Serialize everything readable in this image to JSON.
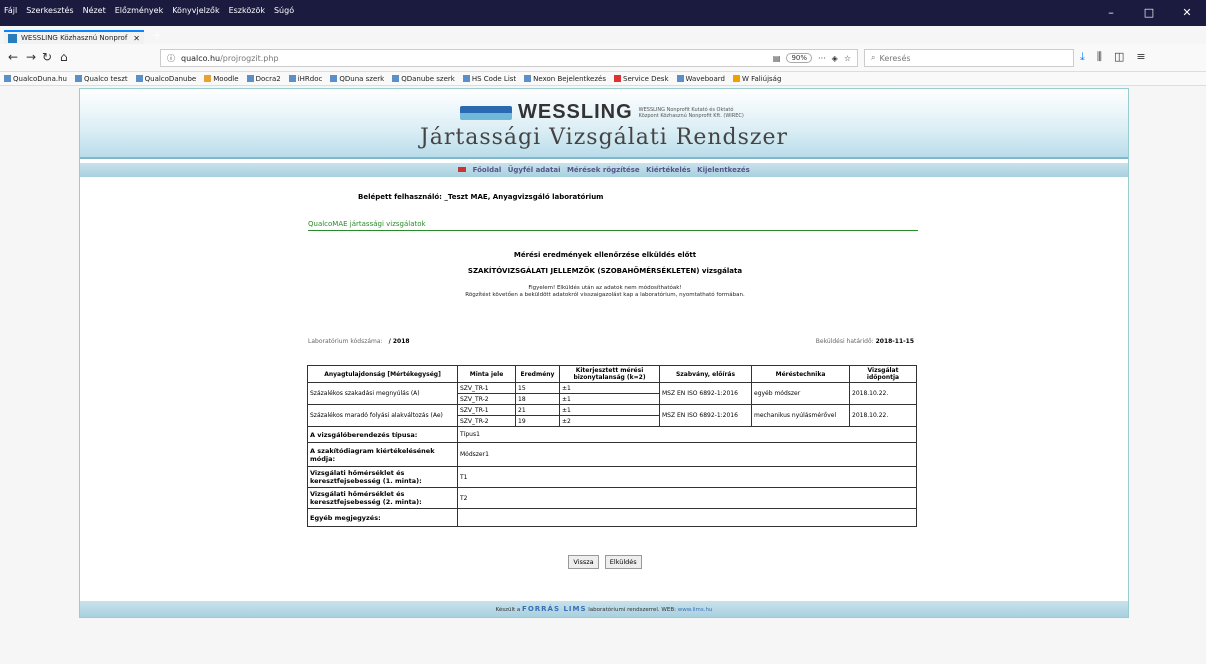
{
  "browser": {
    "menu": [
      "Fájl",
      "Szerkesztés",
      "Nézet",
      "Előzmények",
      "Könyvjelzők",
      "Eszközök",
      "Súgó"
    ],
    "tab_title": "WESSLING Közhasznú Nonprof",
    "url_host": "qualco.hu",
    "url_path": "/projrogzit.php",
    "zoom": "90%",
    "search_placeholder": "Keresés",
    "bookmarks": [
      "QualcoDuna.hu",
      "Qualco teszt",
      "QualcoDanube",
      "Moodle",
      "Docra2",
      "iHRdoc",
      "QDuna szerk",
      "QDanube szerk",
      "HS Code List",
      "Nexon Bejelentkezés",
      "Service Desk",
      "Waveboard",
      "W Faliújság"
    ]
  },
  "header": {
    "logo": "WESSLING",
    "logo_sub1": "WESSLING Nonprofit Kutató és Oktató",
    "logo_sub2": "Központ Közhasznú Nonprofit Kft. (WIREC)",
    "system_name": "Jártassági Vizsgálati Rendszer"
  },
  "nav": [
    "Főoldal",
    "Ügyfél adatai",
    "Mérések rögzítése",
    "Kiértékelés",
    "Kijelentkezés"
  ],
  "user_line": "Belépett felhasználó: _Teszt MAE, Anyagvizsgáló laboratórium",
  "section_title": "QualcoMAE jártassági vizsgálatok",
  "heading1": "Mérési eredmények ellenőrzése elküldés előtt",
  "heading2": "SZAKÍTÓVIZSGÁLATI JELLEMZŐK (SZOBAHŐMÉRSÉKLETEN) vizsgálata",
  "warning1": "Figyelem! Elküldés után az adatok nem módosíthatóak!",
  "warning2": "Rögzítést követően a beküldött adatokról visszaigazolást kap a laboratórium, nyomtatható formában.",
  "lab_label": "Laboratórium kódszáma:",
  "lab_value": "/ 2018",
  "deadline_label": "Beküldési határidő:",
  "deadline_value": "2018-11-15",
  "table": {
    "headers": [
      "Anyagtulajdonság [Mértékegység]",
      "Minta jele",
      "Eredmény",
      "Kiterjesztett mérési bizonytalanság (k=2)",
      "Szabvány, előírás",
      "Méréstechnika",
      "Vizsgálat időpontja"
    ],
    "rows": [
      {
        "prop": "Százalékos szakadási megnyúlás (A)",
        "samples": [
          [
            "SZV_TR-1",
            "15",
            "±1"
          ],
          [
            "SZV_TR-2",
            "18",
            "±1"
          ]
        ],
        "standard": "MSZ EN ISO 6892-1:2016",
        "technique": "egyéb módszer",
        "date": "2018.10.22."
      },
      {
        "prop": "Százalékos maradó folyási alakváltozás (Ae)",
        "samples": [
          [
            "SZV_TR-1",
            "21",
            "±1"
          ],
          [
            "SZV_TR-2",
            "19",
            "±2"
          ]
        ],
        "standard": "MSZ EN ISO 6892-1:2016",
        "technique": "mechanikus nyúlásmérővel",
        "date": "2018.10.22."
      }
    ],
    "extra": [
      {
        "label": "A vizsgálóberendezés típusa:",
        "value": "Típus1"
      },
      {
        "label": "A szakítódiagram kiértékelésének módja:",
        "value": "Módszer1"
      },
      {
        "label": "Vizsgálati hőmérséklet és keresztfejsebesség (1. minta):",
        "value": "T1"
      },
      {
        "label": "Vizsgálati hőmérséklet és keresztfejsebesség (2. minta):",
        "value": "T2"
      },
      {
        "label": "Egyéb megjegyzés:",
        "value": ""
      }
    ]
  },
  "buttons": {
    "back": "Vissza",
    "send": "Elküldés"
  },
  "footer": {
    "pre": "Készült a",
    "brand": "FORRÁS LIMS",
    "mid": "laboratóriumi rendszerrel.  WEB:",
    "web": "www.lims.hu"
  }
}
